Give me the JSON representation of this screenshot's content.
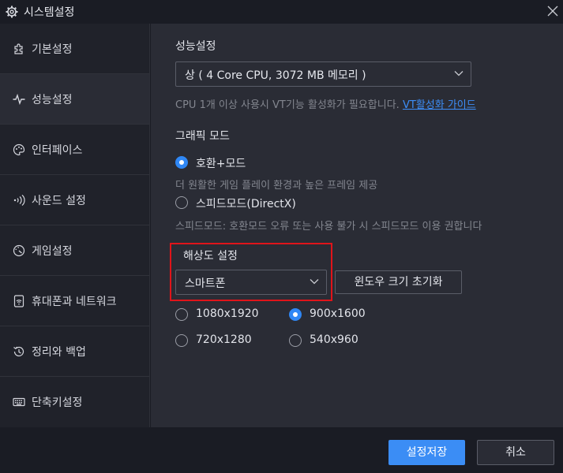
{
  "window": {
    "title": "시스템설정"
  },
  "sidebar": {
    "items": [
      {
        "label": "기본설정",
        "icon": "puzzle-icon"
      },
      {
        "label": "성능설정",
        "icon": "pulse-icon",
        "active": true
      },
      {
        "label": "인터페이스",
        "icon": "palette-icon"
      },
      {
        "label": "사운드 설정",
        "icon": "sound-icon"
      },
      {
        "label": "게임설정",
        "icon": "gauge-icon"
      },
      {
        "label": "휴대폰과 네트워크",
        "icon": "phone-wifi-icon"
      },
      {
        "label": "정리와 백업",
        "icon": "history-icon"
      },
      {
        "label": "단축키설정",
        "icon": "keyboard-icon"
      }
    ]
  },
  "performance": {
    "title": "성능설정",
    "selected": "상 ( 4 Core CPU, 3072 MB 메모리 )",
    "hint": "CPU 1개 이상 사용시 VT기능 활성화가 필요합니다.",
    "link": "VT활성화 가이드"
  },
  "graphics": {
    "title": "그래픽 모드",
    "options": [
      {
        "label": "호환+모드",
        "checked": true,
        "desc": "더 원활한 게임 플레이 환경과 높은 프레임 제공"
      },
      {
        "label": "스피드모드(DirectX)",
        "checked": false,
        "desc": "스피드모드: 호환모드 오류 또는 사용 불가 시 스피드모드 이용 권합니다"
      }
    ]
  },
  "resolution": {
    "title": "해상도 설정",
    "selected": "스마트폰",
    "reset_label": "윈도우 크기 초기화",
    "options": [
      {
        "label": "1080x1920",
        "checked": false
      },
      {
        "label": "900x1600",
        "checked": true
      },
      {
        "label": "720x1280",
        "checked": false
      },
      {
        "label": "540x960",
        "checked": false
      }
    ]
  },
  "footer": {
    "save_label": "설정저장",
    "cancel_label": "취소"
  },
  "colors": {
    "accent": "#3b8df5",
    "highlight": "#e0141a",
    "link": "#3d8ef8"
  }
}
